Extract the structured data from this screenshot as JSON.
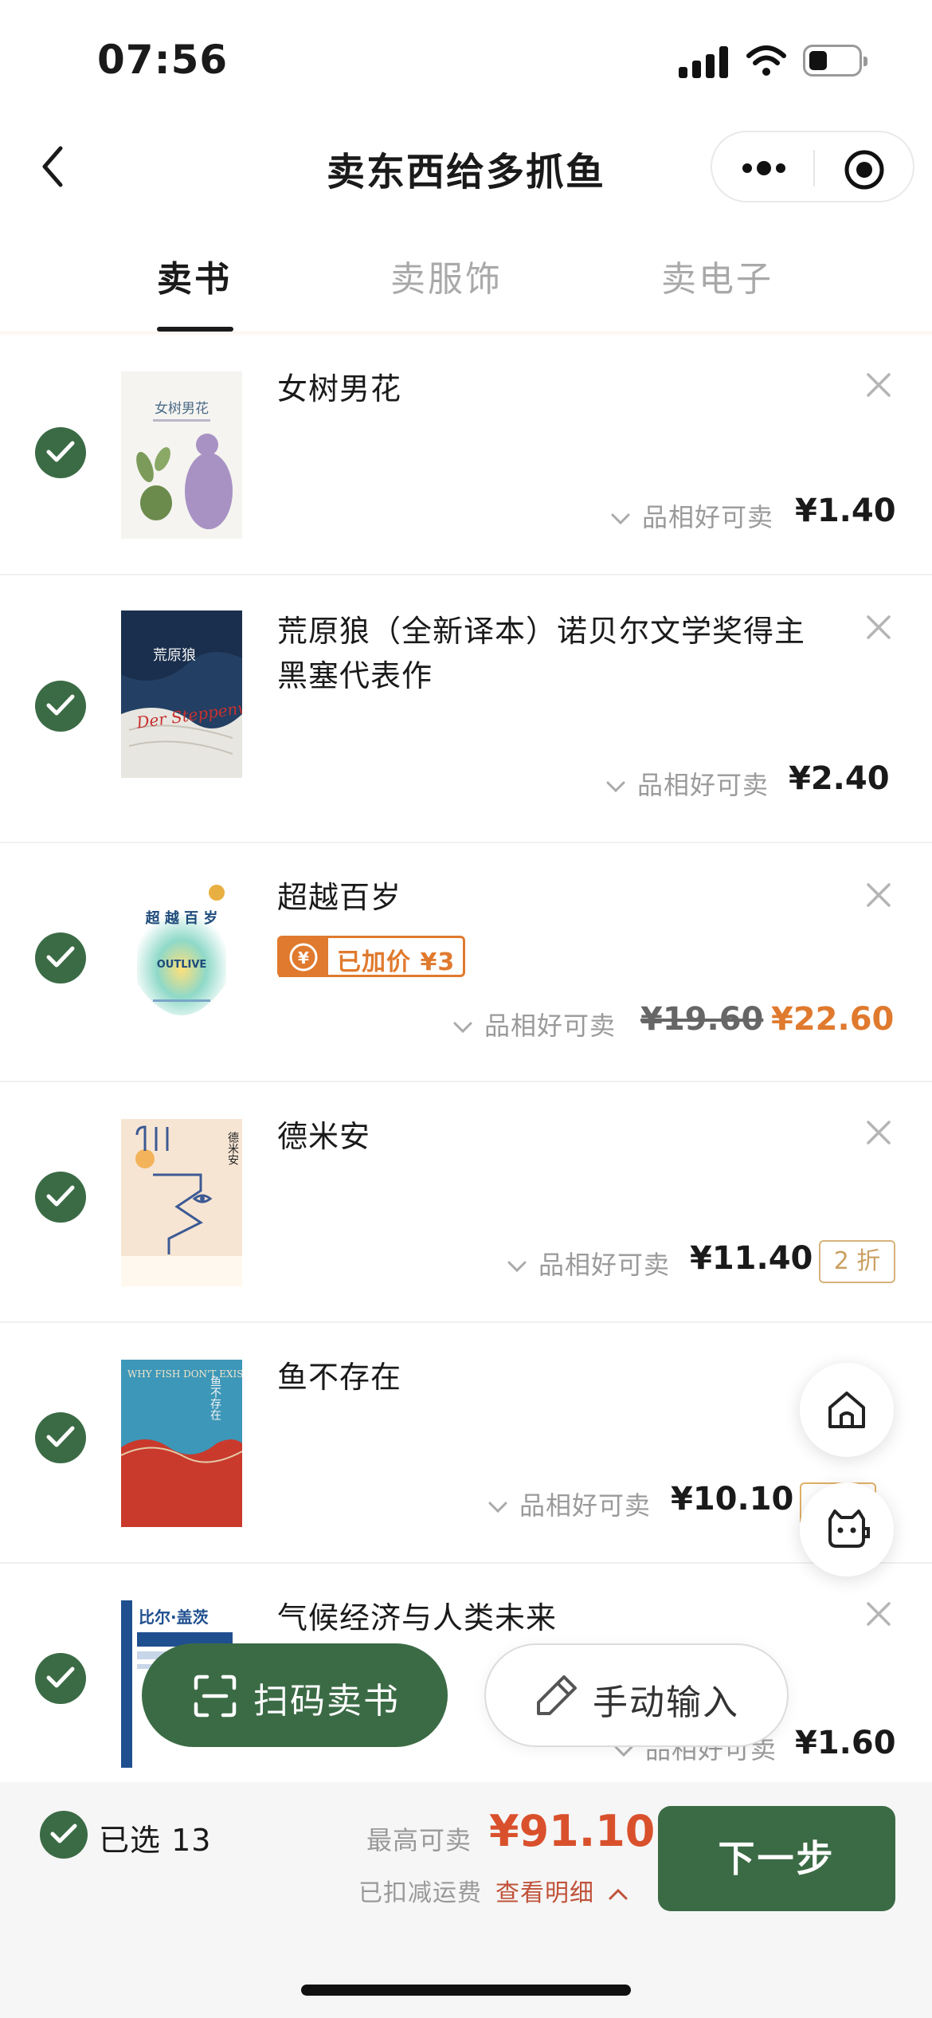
{
  "status_bar": {
    "time": "07:56"
  },
  "nav": {
    "title": "卖东西给多抓鱼"
  },
  "tabs": [
    {
      "label": "卖书",
      "active": true
    },
    {
      "label": "卖服饰",
      "active": false
    },
    {
      "label": "卖电子",
      "active": false
    }
  ],
  "items": [
    {
      "title": "女树男花",
      "condition": "品相好可卖",
      "price": "¥1.40",
      "selected": true
    },
    {
      "title": "荒原狼（全新译本）诺贝尔文学奖得主黑塞代表作",
      "condition": "品相好可卖",
      "price": "¥2.40",
      "selected": true
    },
    {
      "title": "超越百岁",
      "badge": "已加价 ¥3",
      "condition": "品相好可卖",
      "old_price": "¥19.60",
      "price": "¥22.60",
      "selected": true
    },
    {
      "title": "德米安",
      "condition": "品相好可卖",
      "price": "¥11.40",
      "discount": "2 折",
      "selected": true
    },
    {
      "title": "鱼不存在",
      "condition": "品相好可卖",
      "price": "¥10.10",
      "selected": true
    },
    {
      "title": "气候经济与人类未来",
      "condition": "品相好可卖",
      "price": "¥1.60",
      "selected": true
    }
  ],
  "covers": {
    "c1_title": "女树男花",
    "c2_title": "荒原狼",
    "c2_script": "Der Steppenwolf",
    "c3_title": "超 越 百 岁",
    "c3_sub": "OUTLIVE",
    "c4_title": "德米安",
    "c5_title": "WHY FISH DON'T EXIST",
    "c5_cn": "鱼不存在",
    "c6_author": "比尔·盖茨"
  },
  "actions": {
    "scan_label": "扫码卖书",
    "manual_label": "手动输入"
  },
  "bottom_bar": {
    "selected_label": "已选 13",
    "max_label": "最高可卖",
    "max_price": "¥91.10",
    "shipping_label": "已扣减运费",
    "detail_label": "查看明细",
    "next_label": "下一步"
  },
  "colors": {
    "brand_green": "#3b6b45",
    "accent_orange": "#e07a2e",
    "price_red": "#d9512c"
  },
  "icons": [
    "back-icon",
    "more-icon",
    "target-icon",
    "check-icon",
    "close-icon",
    "chevron-down-icon",
    "home-icon",
    "chat-bot-icon",
    "scan-icon",
    "pen-icon",
    "chevron-up-icon"
  ]
}
